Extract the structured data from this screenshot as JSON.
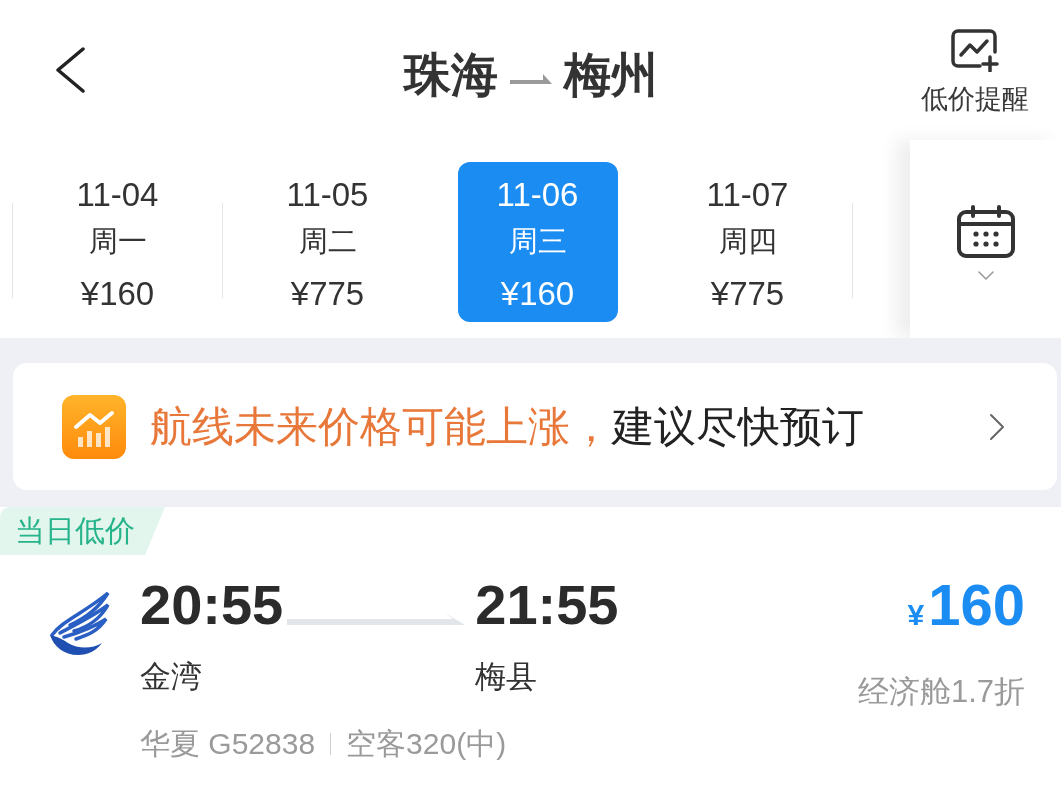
{
  "header": {
    "origin": "珠海",
    "destination": "梅州",
    "price_alert": "低价提醒"
  },
  "dates": [
    {
      "date": "11-04",
      "weekday": "周一",
      "price": "¥160",
      "selected": false
    },
    {
      "date": "11-05",
      "weekday": "周二",
      "price": "¥775",
      "selected": false
    },
    {
      "date": "11-06",
      "weekday": "周三",
      "price": "¥160",
      "selected": true
    },
    {
      "date": "11-07",
      "weekday": "周四",
      "price": "¥775",
      "selected": false
    }
  ],
  "banner": {
    "warning": "航线未来价格可能上涨，",
    "advice": "建议尽快预订"
  },
  "flight": {
    "tag": "当日低价",
    "depart_time": "20:55",
    "depart_airport": "金湾",
    "arrive_time": "21:55",
    "arrive_airport": "梅县",
    "currency": "¥",
    "price": "160",
    "cabin": "经济舱1.7折",
    "airline_flight": "华夏 G52838",
    "aircraft": "空客320(中)"
  }
}
